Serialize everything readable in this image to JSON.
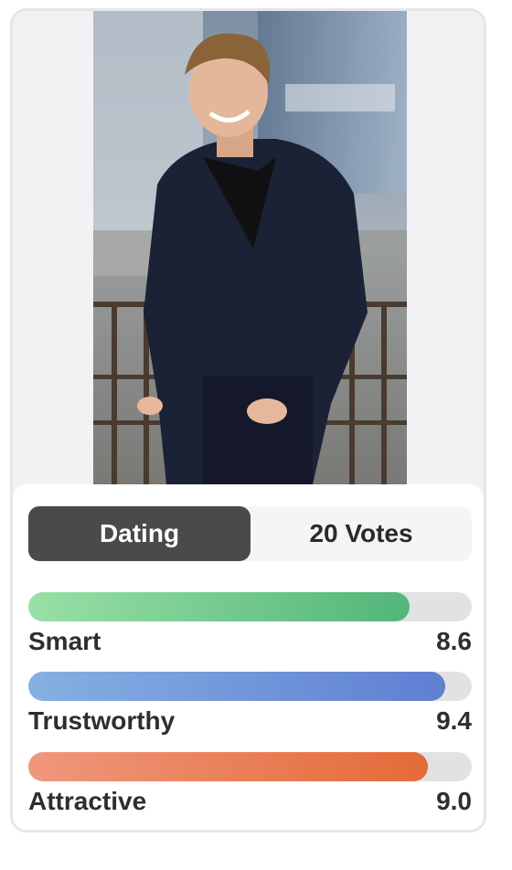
{
  "toggle": {
    "active_label": "Dating",
    "votes_label": "20 Votes"
  },
  "metrics": [
    {
      "label": "Smart",
      "value": "8.6",
      "fraction": 0.86,
      "color_start": "#98e0a6",
      "color_end": "#52b679"
    },
    {
      "label": "Trustworthy",
      "value": "9.4",
      "fraction": 0.94,
      "color_start": "#86b0e2",
      "color_end": "#5f7fd2"
    },
    {
      "label": "Attractive",
      "value": "9.0",
      "fraction": 0.9,
      "color_start": "#f0977c",
      "color_end": "#e46b37"
    }
  ],
  "colors": {
    "active_toggle_bg": "#4a4a4a",
    "track_bg": "#e2e2e2"
  },
  "icons": {
    "photo": "profile-photo"
  }
}
